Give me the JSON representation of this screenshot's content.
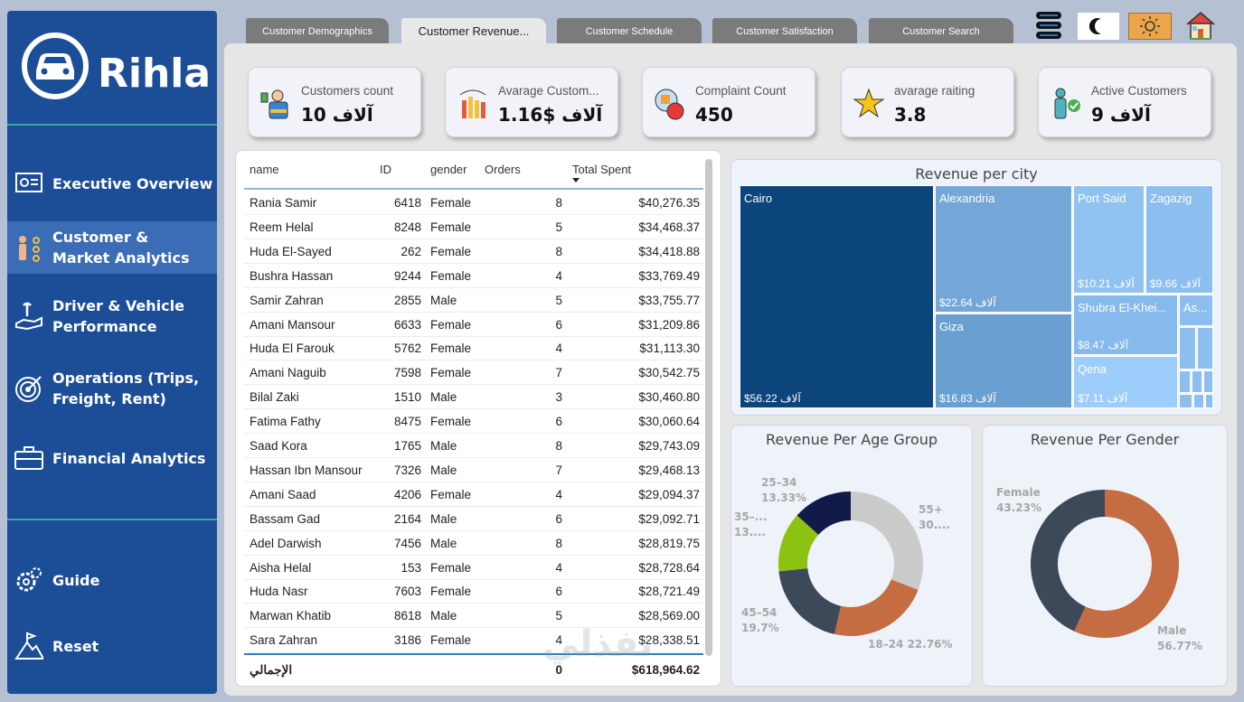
{
  "brand": {
    "name": "Rihla"
  },
  "sidebar": {
    "items": [
      {
        "label": "Executive Overview",
        "icon": "presentation-icon"
      },
      {
        "label": "Customer & Market Analytics",
        "icon": "people-network-icon",
        "active": true
      },
      {
        "label": "Driver & Vehicle Performance",
        "icon": "wrench-hand-icon"
      },
      {
        "label": "Operations (Trips, Freight, Rent)",
        "icon": "target-icon"
      },
      {
        "label": "Financial Analytics",
        "icon": "briefcase-icon"
      }
    ],
    "bottom": [
      {
        "label": "Guide",
        "icon": "gears-icon"
      },
      {
        "label": "Reset",
        "icon": "flag-mountain-icon"
      }
    ]
  },
  "tabs": [
    {
      "label": "Customer Demographics"
    },
    {
      "label": "Customer Revenue...",
      "active": true
    },
    {
      "label": "Customer Schedule"
    },
    {
      "label": "Customer Satisfaction"
    },
    {
      "label": "Customer Search"
    }
  ],
  "toolbar": {
    "icons": [
      "database-icon",
      "moon-icon",
      "sun-icon",
      "home-icon"
    ]
  },
  "kpis": [
    {
      "label": "Customers count",
      "value": "آلاف 10"
    },
    {
      "label": "Avarage Custom...",
      "value": "آلاف $1.16"
    },
    {
      "label": "Complaint Count",
      "value": "450"
    },
    {
      "label": "avarage raiting",
      "value": "3.8"
    },
    {
      "label": "Active Customers",
      "value": "آلاف 9"
    }
  ],
  "table": {
    "headers": [
      "name",
      "ID",
      "gender",
      "Orders",
      "Total Spent"
    ],
    "rows": [
      [
        "Rania Samir",
        "6418",
        "Female",
        "8",
        "$40,276.35"
      ],
      [
        "Reem Helal",
        "8248",
        "Female",
        "5",
        "$34,468.37"
      ],
      [
        "Huda El-Sayed",
        "262",
        "Female",
        "8",
        "$34,418.88"
      ],
      [
        "Bushra Hassan",
        "9244",
        "Female",
        "4",
        "$33,769.49"
      ],
      [
        "Samir Zahran",
        "2855",
        "Male",
        "5",
        "$33,755.77"
      ],
      [
        "Amani Mansour",
        "6633",
        "Female",
        "6",
        "$31,209.86"
      ],
      [
        "Huda El Farouk",
        "5762",
        "Female",
        "4",
        "$31,113.30"
      ],
      [
        "Amani Naguib",
        "7598",
        "Female",
        "7",
        "$30,542.75"
      ],
      [
        "Bilal Zaki",
        "1510",
        "Male",
        "3",
        "$30,460.80"
      ],
      [
        "Fatima Fathy",
        "8475",
        "Female",
        "6",
        "$30,060.64"
      ],
      [
        "Saad Kora",
        "1765",
        "Male",
        "8",
        "$29,743.09"
      ],
      [
        "Hassan Ibn Mansour",
        "7326",
        "Male",
        "7",
        "$29,468.13"
      ],
      [
        "Amani Saad",
        "4206",
        "Female",
        "4",
        "$29,094.37"
      ],
      [
        "Bassam Gad",
        "2164",
        "Male",
        "6",
        "$29,092.71"
      ],
      [
        "Adel Darwish",
        "7456",
        "Male",
        "8",
        "$28,819.75"
      ],
      [
        "Aisha Helal",
        "153",
        "Female",
        "4",
        "$28,728.64"
      ],
      [
        "Huda Nasr",
        "7603",
        "Female",
        "6",
        "$28,721.49"
      ],
      [
        "Marwan Khatib",
        "8618",
        "Male",
        "5",
        "$28,569.00"
      ],
      [
        "Sara Zahran",
        "3186",
        "Female",
        "4",
        "$28,338.51"
      ]
    ],
    "total": {
      "label": "الإجمالي",
      "orders": "0",
      "spent": "$618,964.62"
    }
  },
  "watermark": "نفذلي nafezly.com",
  "chart_data": [
    {
      "type": "treemap",
      "title": "Revenue per city",
      "unit": "آلاف $",
      "categories": [
        "Cairo",
        "Alexandria",
        "Giza",
        "Port Said",
        "Zagazig",
        "Shubra El-Khei...",
        "Qena",
        "As..."
      ],
      "values": [
        56.22,
        22.64,
        16.83,
        10.21,
        9.66,
        8.47,
        7.11,
        null
      ],
      "labels": [
        "$56.22 آلاف",
        "$22.64 آلاف",
        "$16.83 آلاف",
        "$10.21 آلاف",
        "$9.66 آلاف",
        "$8.47 آلاف",
        "$7.11 آلاف",
        ""
      ],
      "colors": [
        "#0c447c",
        "#74a7d8",
        "#6a9fd2",
        "#91c3f0",
        "#8cbff0",
        "#86b9ec",
        "#9dcdfa",
        "#8cbff0"
      ]
    },
    {
      "type": "pie",
      "title": "Revenue Per Age Group",
      "donut": true,
      "categories": [
        "55+",
        "18–24",
        "45–54",
        "35–44",
        "25–34"
      ],
      "values": [
        30.88,
        22.76,
        19.7,
        13.33,
        13.33
      ],
      "labels": [
        "55+\n30....",
        "18–24 22.76%",
        "45–54\n19.7%",
        "35–...\n13....",
        "25–34\n13.33%"
      ],
      "colors": [
        "#cbcbcb",
        "#c46c42",
        "#3d4859",
        "#8cc211",
        "#121a4a"
      ]
    },
    {
      "type": "pie",
      "title": "Revenue Per Gender",
      "donut": true,
      "categories": [
        "Male",
        "Female"
      ],
      "values": [
        56.77,
        43.23
      ],
      "labels": [
        "Male\n56.77%",
        "Female\n43.23%"
      ],
      "colors": [
        "#c46c42",
        "#3d4859"
      ]
    }
  ]
}
